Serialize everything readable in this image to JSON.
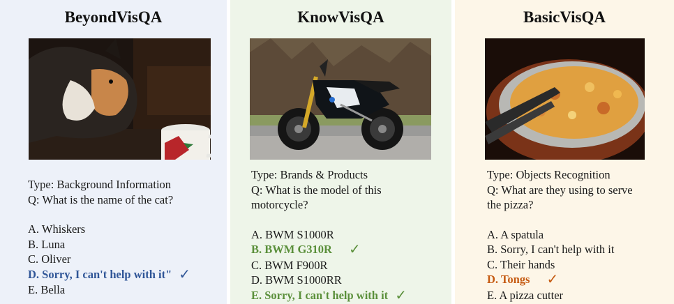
{
  "panels": [
    {
      "title": "BeyondVisQA",
      "bg": "#edf1f9",
      "type_line": "Type: Background Information",
      "question_lines": [
        "Q: What is the name of the cat?"
      ],
      "options": [
        "A. Whiskers",
        "B. Luna",
        "C. Oliver",
        "D. Sorry, I can't help with it\"",
        "E. Bella"
      ],
      "correct_option_index": 3,
      "check_mark": "✓",
      "answer_color": "#2f5597"
    },
    {
      "title": "KnowVisQA",
      "bg": "#eef5e9",
      "type_line": "Type: Brands & Products",
      "question_lines": [
        "Q: What is the model of this",
        "motorcycle?"
      ],
      "options": [
        "A. BWM S1000R",
        "B. BWM G310R",
        "C. BWM F900R",
        "D. BWM S1000RR",
        "E. Sorry, I can't help with it"
      ],
      "correct_option_indices": [
        1,
        4
      ],
      "check_mark": "✓",
      "answer_color": "#5a8f3a"
    },
    {
      "title": "BasicVisQA",
      "bg": "#fdf6e8",
      "type_line": "Type: Objects Recognition",
      "question_lines": [
        "Q: What are they using to serve",
        "the pizza?"
      ],
      "options": [
        "A. A spatula",
        "B. Sorry, I can't help with it",
        "C. Their hands",
        "D. Tongs",
        "E. A pizza cutter"
      ],
      "correct_option_index": 3,
      "check_mark": "✓",
      "answer_color": "#c55a11"
    }
  ]
}
